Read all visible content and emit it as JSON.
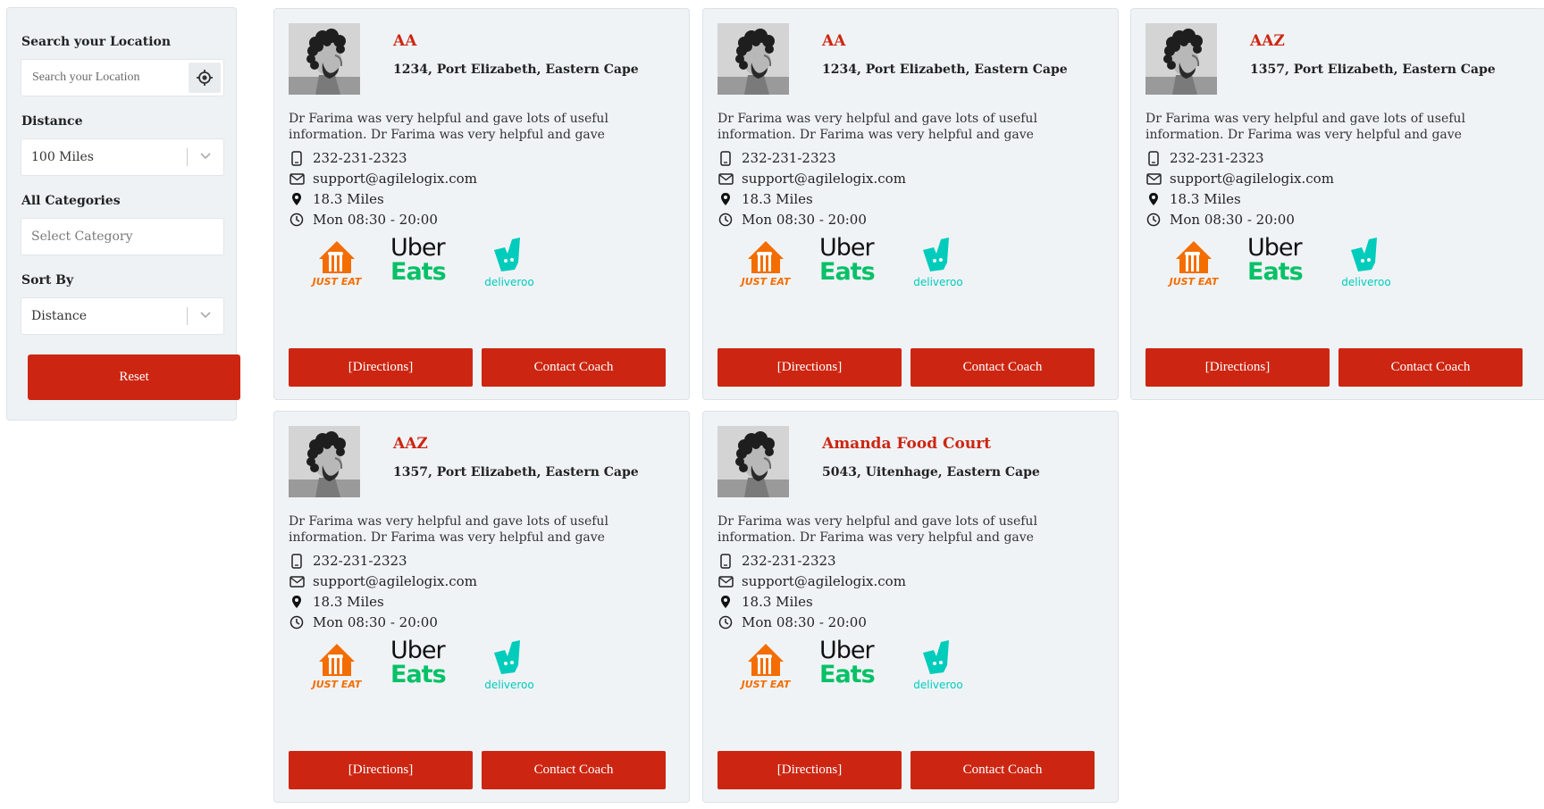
{
  "filters": {
    "search_label": "Search your Location",
    "search_placeholder": "Search your Location",
    "distance_label": "Distance",
    "distance_value": "100 Miles",
    "categories_label": "All Categories",
    "categories_placeholder": "Select Category",
    "sort_label": "Sort By",
    "sort_value": "Distance",
    "reset_label": "Reset"
  },
  "cards": [
    {
      "name": "AA",
      "address": "1234, Port Elizabeth, Eastern Cape",
      "description": "Dr Farima was very helpful and gave lots of useful information. Dr Farima was very helpful and gave",
      "phone": "232-231-2323",
      "email": "support@agilelogix.com",
      "distance": "18.3 Miles",
      "hours": "Mon 08:30 - 20:00",
      "directions_label": "[Directions]",
      "contact_label": "Contact Coach"
    },
    {
      "name": "AA",
      "address": "1234, Port Elizabeth, Eastern Cape",
      "description": "Dr Farima was very helpful and gave lots of useful information. Dr Farima was very helpful and gave",
      "phone": "232-231-2323",
      "email": "support@agilelogix.com",
      "distance": "18.3 Miles",
      "hours": "Mon 08:30 - 20:00",
      "directions_label": "[Directions]",
      "contact_label": "Contact Coach"
    },
    {
      "name": "AAZ",
      "address": "1357, Port Elizabeth, Eastern Cape",
      "description": "Dr Farima was very helpful and gave lots of useful information. Dr Farima was very helpful and gave",
      "phone": "232-231-2323",
      "email": "support@agilelogix.com",
      "distance": "18.3 Miles",
      "hours": "Mon 08:30 - 20:00",
      "directions_label": "[Directions]",
      "contact_label": "Contact Coach"
    },
    {
      "name": "AAZ",
      "address": "1357, Port Elizabeth, Eastern Cape",
      "description": "Dr Farima was very helpful and gave lots of useful information. Dr Farima was very helpful and gave",
      "phone": "232-231-2323",
      "email": "support@agilelogix.com",
      "distance": "18.3 Miles",
      "hours": "Mon 08:30 - 20:00",
      "directions_label": "[Directions]",
      "contact_label": "Contact Coach"
    },
    {
      "name": "Amanda Food Court",
      "address": "5043, Uitenhage, Eastern Cape",
      "description": "Dr Farima was very helpful and gave lots of useful information. Dr Farima was very helpful and gave",
      "phone": "232-231-2323",
      "email": "support@agilelogix.com",
      "distance": "18.3 Miles",
      "hours": "Mon 08:30 - 20:00",
      "directions_label": "[Directions]",
      "contact_label": "Contact Coach"
    }
  ],
  "delivery_logos": {
    "just_eat": "JUST EAT",
    "uber_eats_line1": "Uber",
    "uber_eats_line2": "Eats",
    "deliveroo": "deliveroo"
  },
  "colors": {
    "accent": "#cc2612",
    "card_bg": "#f0f3f6",
    "just_eat": "#f36d00",
    "uber_eats_green": "#06c167",
    "deliveroo": "#00ccbc"
  }
}
